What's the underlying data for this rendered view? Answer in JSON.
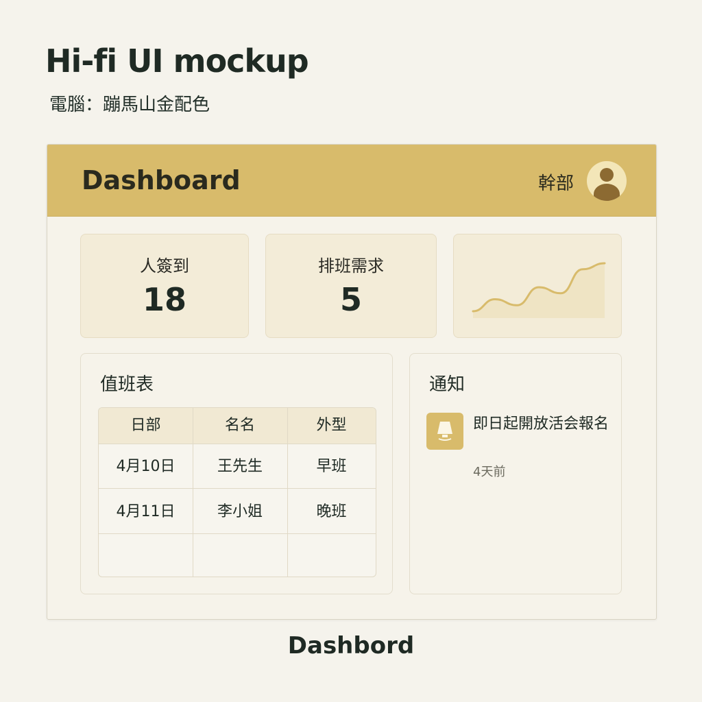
{
  "page": {
    "title": "Hi-fi UI mockup",
    "subtitle": "電腦：蹦馬山金配色",
    "footer": "Dashbord"
  },
  "topbar": {
    "title": "Dashboard",
    "user_label": "幹部",
    "avatar_icon": "user-avatar-icon"
  },
  "stats": [
    {
      "label": "人簽到",
      "value": "18"
    },
    {
      "label": "排班需求",
      "value": "5"
    }
  ],
  "trend_chart": {
    "type": "area",
    "values": [
      2,
      4,
      3,
      6,
      5,
      9,
      10
    ],
    "line_color": "#d8bb6b",
    "fill_color": "#efe4c4"
  },
  "schedule": {
    "title": "值班表",
    "columns": [
      "日部",
      "名名",
      "外型"
    ],
    "rows": [
      [
        "4月10日",
        "王先生",
        "早班"
      ],
      [
        "4月11日",
        "李小姐",
        "晚班"
      ],
      [
        "",
        "",
        ""
      ]
    ]
  },
  "notices": {
    "title": "通知",
    "items": [
      {
        "icon": "lamp-icon",
        "text": "即日起開放活会報名",
        "time": "4天前"
      }
    ]
  },
  "colors": {
    "accent": "#d8bb6b",
    "background": "#f5f3ec",
    "card": "#f3ecd8",
    "text": "#1f2a24"
  }
}
